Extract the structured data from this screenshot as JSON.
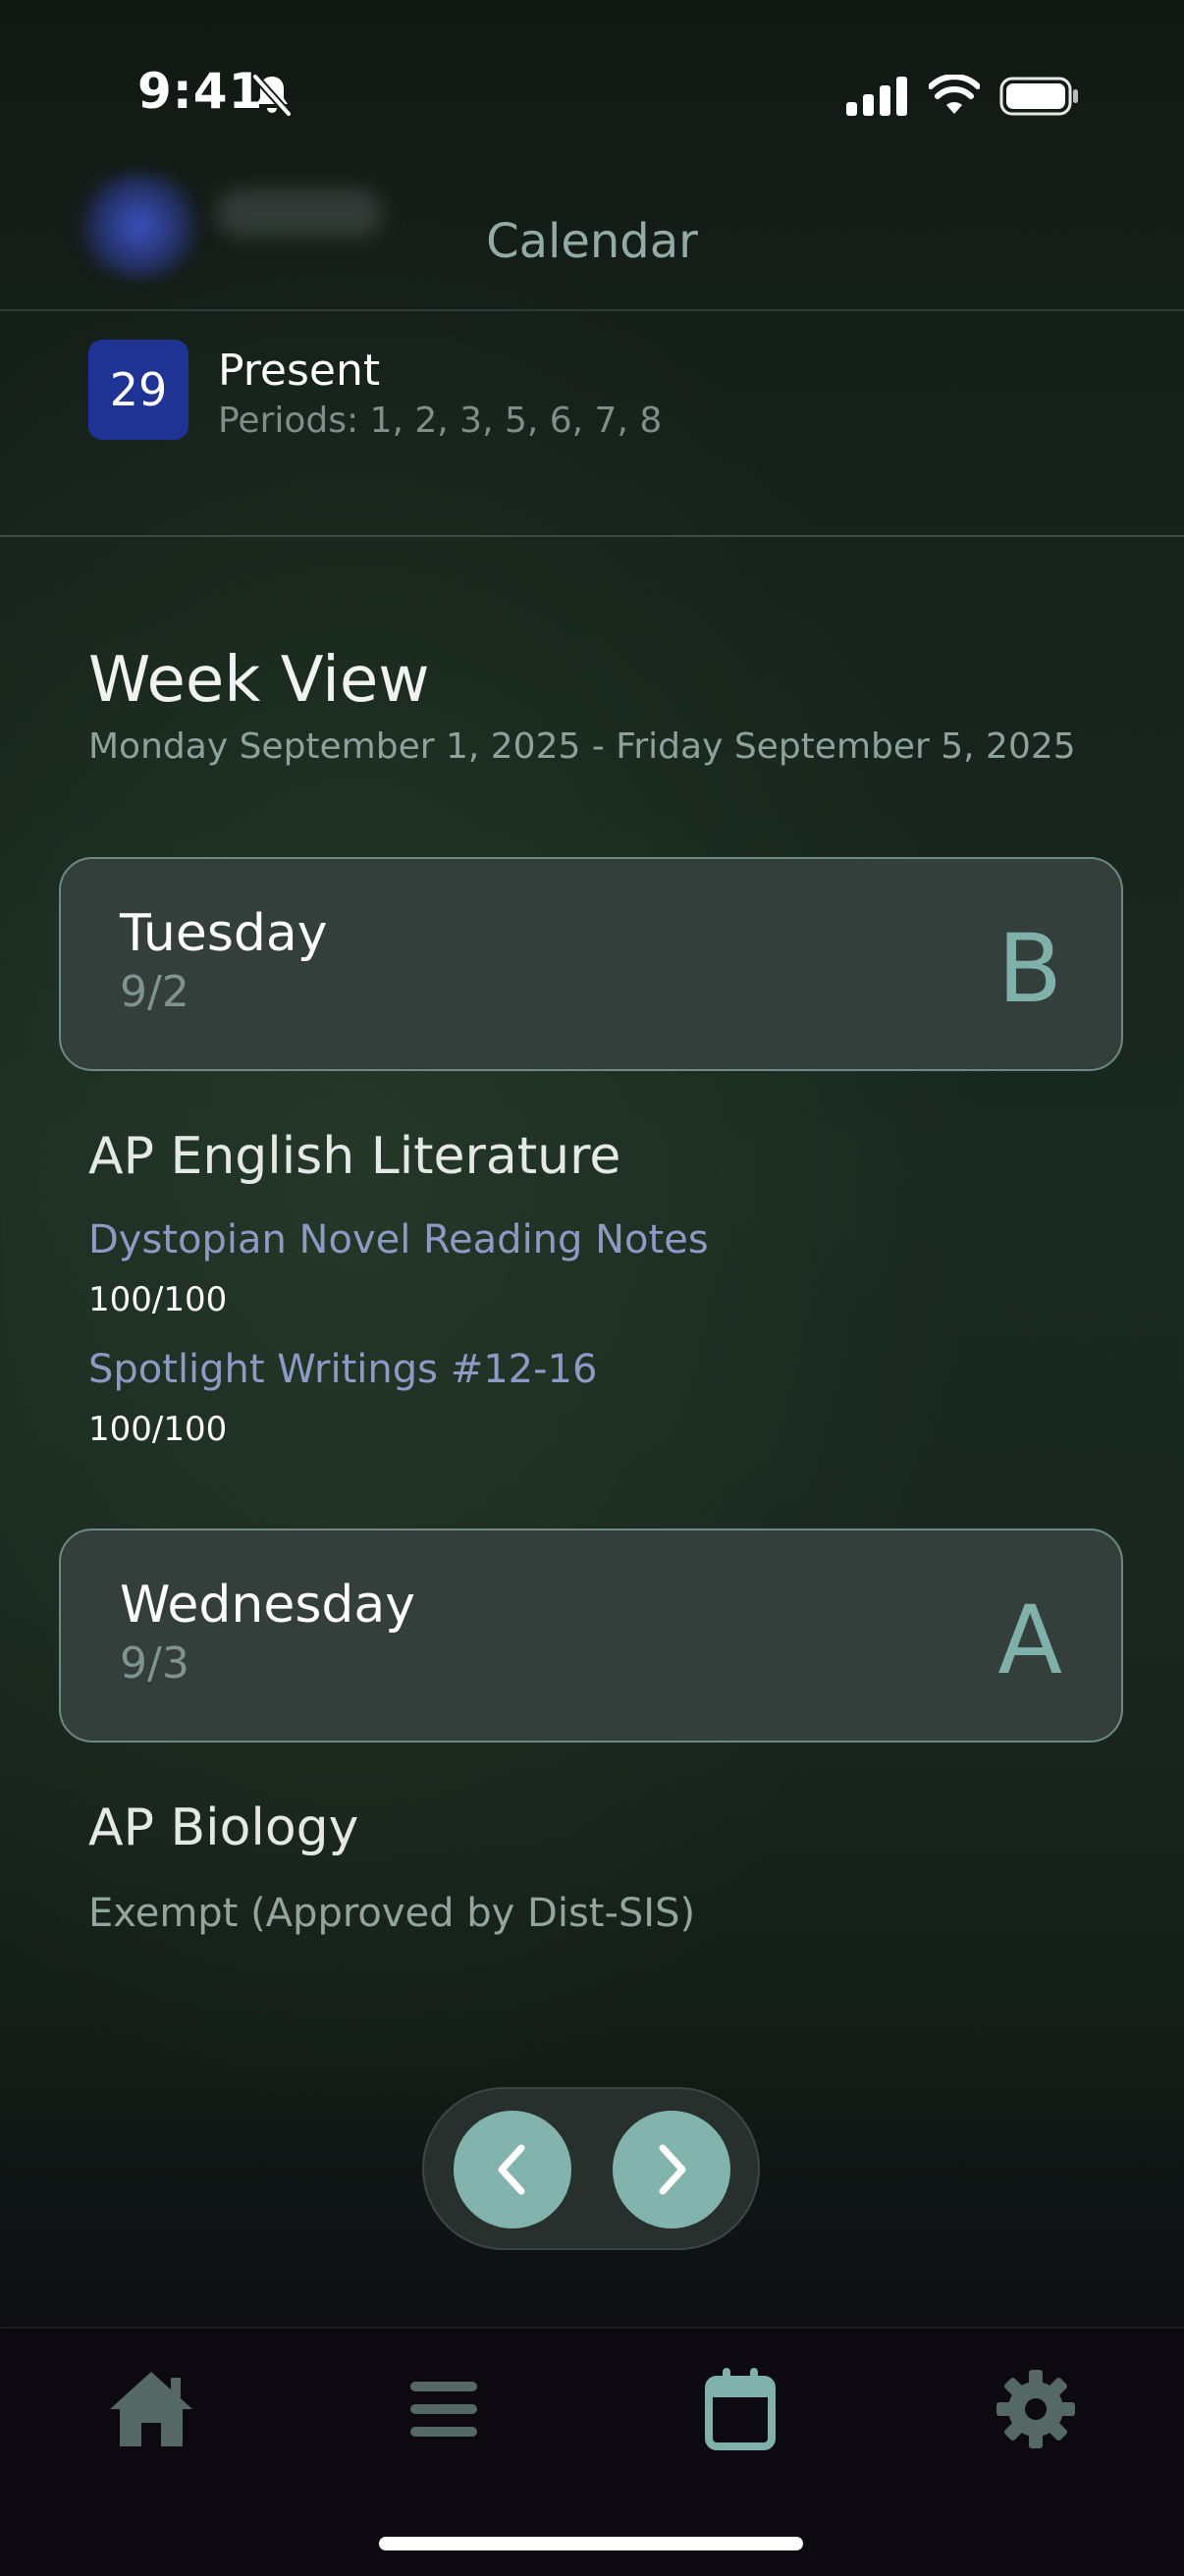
{
  "status_bar": {
    "time": "9:41"
  },
  "header": {
    "title": "Calendar"
  },
  "attendance": {
    "day": "29",
    "status": "Present",
    "periods": "Periods: 1, 2, 3, 5, 6, 7, 8"
  },
  "week_view": {
    "title": "Week View",
    "range": "Monday September 1, 2025 - Friday September 5, 2025",
    "days": [
      {
        "name": "Tuesday",
        "date": "9/2",
        "letter": "B",
        "course": "AP English Literature",
        "assignments": [
          {
            "title": "Dystopian Novel Reading Notes",
            "score": "100/100"
          },
          {
            "title": "Spotlight Writings #12-16",
            "score": "100/100"
          }
        ]
      },
      {
        "name": "Wednesday",
        "date": "9/3",
        "letter": "A",
        "course": "AP Biology",
        "note": "Exempt (Approved by Dist-SIS)"
      }
    ]
  },
  "pager": {
    "prev_icon": "chevron-left-icon",
    "next_icon": "chevron-right-icon"
  },
  "tab_bar": {
    "items": [
      {
        "icon": "home-icon",
        "active": false
      },
      {
        "icon": "menu-icon",
        "active": false
      },
      {
        "icon": "calendar-icon",
        "active": true
      },
      {
        "icon": "gear-icon",
        "active": false
      }
    ],
    "active_color": "#7fb1aa",
    "inactive_color": "#566864"
  },
  "colors": {
    "accent": "#83b3ad",
    "badge": "#1f3394",
    "link": "#8d9ac4"
  }
}
